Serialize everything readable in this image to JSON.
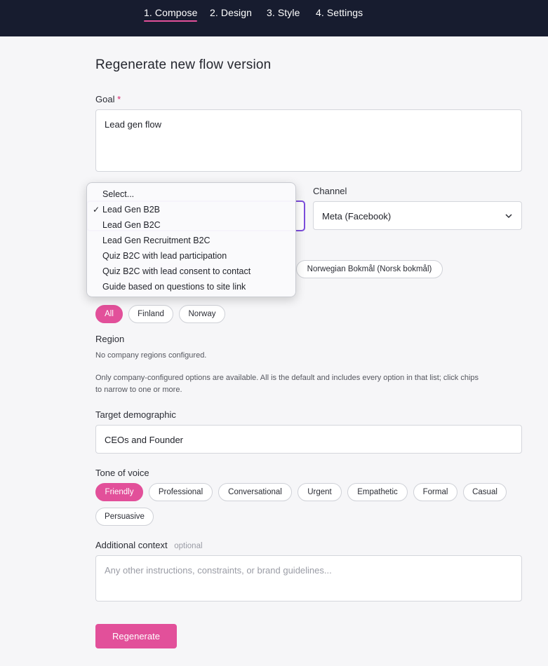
{
  "tabs": [
    "1. Compose",
    "2. Design",
    "3. Style",
    "4. Settings"
  ],
  "title": "Regenerate new flow version",
  "goal": {
    "label": "Goal",
    "required_mark": "*",
    "value": "Lead gen flow"
  },
  "channel": {
    "label": "Channel",
    "value": "Meta (Facebook)"
  },
  "flow_type_dropdown": {
    "items": [
      "Select...",
      "Lead Gen B2B",
      "Lead Gen B2C",
      "Lead Gen Recruitment B2C",
      "Quiz B2C with lead participation",
      "Quiz B2C with lead consent to contact",
      "Guide based on questions to site link"
    ],
    "checked_index": 1,
    "check_mark": "✓"
  },
  "language_chip": "Norwegian Bokmål (Norsk bokmål)",
  "countries": {
    "chips": [
      "All",
      "Finland",
      "Norway"
    ],
    "selected": "All"
  },
  "region": {
    "label": "Region",
    "empty_text": "No company regions configured."
  },
  "hint_text_line1": "Only company-configured options are available. All is the default and includes every option in that list; click chips",
  "hint_text_line2": "to narrow to one or more.",
  "target_demographic": {
    "label": "Target demographic",
    "value": "CEOs and Founder"
  },
  "tone": {
    "label": "Tone of voice",
    "chips": [
      "Friendly",
      "Professional",
      "Conversational",
      "Urgent",
      "Empathetic",
      "Formal",
      "Casual",
      "Persuasive"
    ],
    "selected": "Friendly"
  },
  "additional_context": {
    "label": "Additional context",
    "optional_label": "optional",
    "placeholder": "Any other instructions, constraints, or brand guidelines..."
  },
  "regenerate_label": "Regenerate",
  "colors": {
    "accent": "#e2509a",
    "topbar": "#171c2f",
    "focus": "#7c4ddb"
  }
}
